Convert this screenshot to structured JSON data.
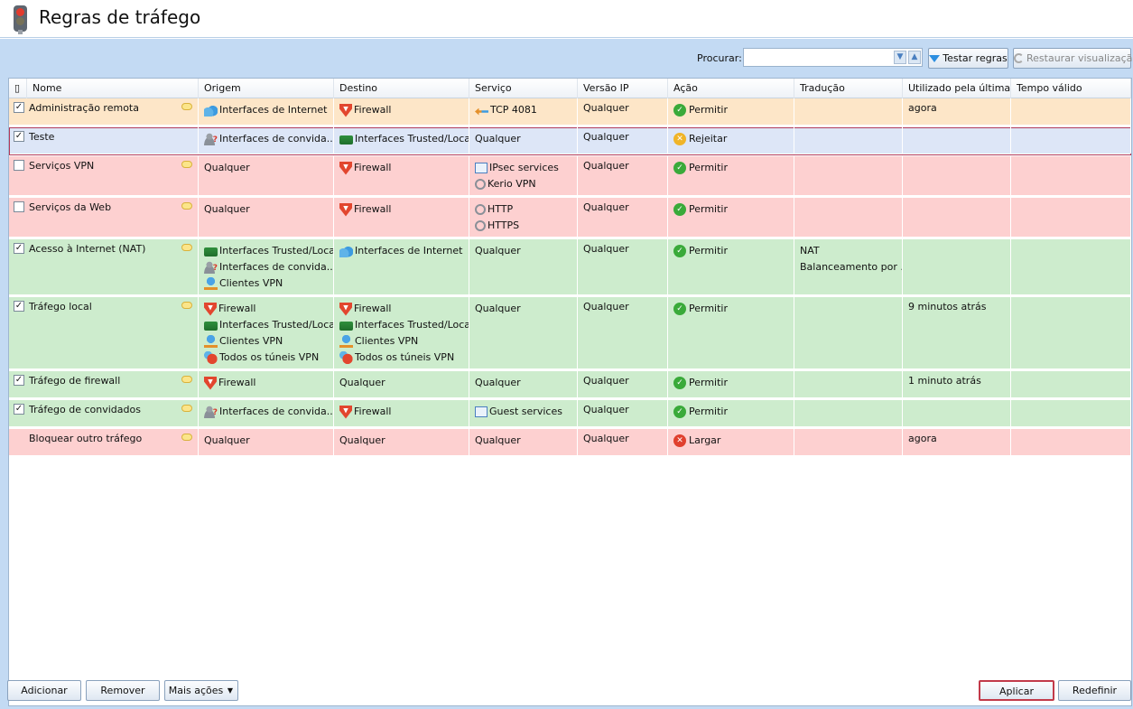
{
  "title": "Regras de tráfego",
  "toolbar": {
    "search_label": "Procurar:",
    "search_value": "",
    "test_rules": "Testar regras",
    "restore_view": "Restaurar visualização"
  },
  "columns": [
    "Nome",
    "Origem",
    "Destino",
    "Serviço",
    "Versão IP",
    "Ação",
    "Tradução",
    "Utilizado pela última ...",
    "Tempo válido"
  ],
  "rows": [
    {
      "checked": true,
      "name": "Administração remota",
      "origem": [
        "Interfaces de Internet"
      ],
      "destino": [
        "Firewall"
      ],
      "servico": [
        "TCP 4081"
      ],
      "ip": "Qualquer",
      "acao": "Permitir",
      "traducao": [],
      "ultima": "agora",
      "tempo": ""
    },
    {
      "checked": true,
      "name": "Teste",
      "origem": [
        "Interfaces de convida..."
      ],
      "destino": [
        "Interfaces Trusted/Local"
      ],
      "servico": [
        "Qualquer"
      ],
      "ip": "Qualquer",
      "acao": "Rejeitar",
      "traducao": [],
      "ultima": "",
      "tempo": ""
    },
    {
      "checked": false,
      "name": "Serviços VPN",
      "origem": [
        "Qualquer"
      ],
      "destino": [
        "Firewall"
      ],
      "servico": [
        "IPsec services",
        "Kerio VPN"
      ],
      "ip": "Qualquer",
      "acao": "Permitir",
      "traducao": [],
      "ultima": "",
      "tempo": ""
    },
    {
      "checked": false,
      "name": "Serviços da Web",
      "origem": [
        "Qualquer"
      ],
      "destino": [
        "Firewall"
      ],
      "servico": [
        "HTTP",
        "HTTPS"
      ],
      "ip": "Qualquer",
      "acao": "Permitir",
      "traducao": [],
      "ultima": "",
      "tempo": ""
    },
    {
      "checked": true,
      "name": "Acesso à Internet (NAT)",
      "origem": [
        "Interfaces Trusted/Local",
        "Interfaces de convida...",
        "Clientes VPN"
      ],
      "destino": [
        "Interfaces de Internet"
      ],
      "servico": [
        "Qualquer"
      ],
      "ip": "Qualquer",
      "acao": "Permitir",
      "traducao": [
        "NAT",
        "Balanceamento por ..."
      ],
      "ultima": "",
      "tempo": ""
    },
    {
      "checked": true,
      "name": "Tráfego local",
      "origem": [
        "Firewall",
        "Interfaces Trusted/Local",
        "Clientes VPN",
        "Todos os túneis VPN"
      ],
      "destino": [
        "Firewall",
        "Interfaces Trusted/Local",
        "Clientes VPN",
        "Todos os túneis VPN"
      ],
      "servico": [
        "Qualquer"
      ],
      "ip": "Qualquer",
      "acao": "Permitir",
      "traducao": [],
      "ultima": "9 minutos atrás",
      "tempo": ""
    },
    {
      "checked": true,
      "name": "Tráfego de firewall",
      "origem": [
        "Firewall"
      ],
      "destino": [
        "Qualquer"
      ],
      "servico": [
        "Qualquer"
      ],
      "ip": "Qualquer",
      "acao": "Permitir",
      "traducao": [],
      "ultima": "1 minuto atrás",
      "tempo": ""
    },
    {
      "checked": true,
      "name": "Tráfego de convidados",
      "origem": [
        "Interfaces de convida..."
      ],
      "destino": [
        "Firewall"
      ],
      "servico": [
        "Guest services"
      ],
      "ip": "Qualquer",
      "acao": "Permitir",
      "traducao": [],
      "ultima": "",
      "tempo": ""
    },
    {
      "checked": null,
      "name": "Bloquear outro tráfego",
      "origem": [
        "Qualquer"
      ],
      "destino": [
        "Qualquer"
      ],
      "servico": [
        "Qualquer"
      ],
      "ip": "Qualquer",
      "acao": "Largar",
      "traducao": [],
      "ultima": "agora",
      "tempo": ""
    }
  ],
  "footer": {
    "add": "Adicionar",
    "remove": "Remover",
    "more": "Mais ações",
    "apply": "Aplicar",
    "reset": "Redefinir"
  },
  "colors": {
    "orange_row": "#fde6c8",
    "blue_row": "#dde6f7",
    "red_row": "#fdd0d0",
    "green_row": "#cdeccd",
    "panel": "#c3daf3"
  }
}
